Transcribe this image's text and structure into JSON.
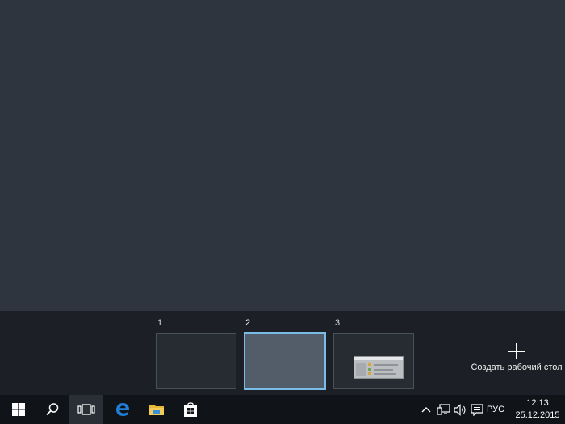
{
  "virtual_desktops": {
    "items": [
      {
        "number": "1",
        "active": false,
        "has_window": false
      },
      {
        "number": "2",
        "active": true,
        "has_window": false
      },
      {
        "number": "3",
        "active": false,
        "has_window": true
      }
    ],
    "create_label": "Создать рабочий стол"
  },
  "taskbar": {
    "buttons": [
      {
        "name": "start-button",
        "icon": "windows-logo-icon"
      },
      {
        "name": "search-button",
        "icon": "search-icon"
      },
      {
        "name": "task-view-button",
        "icon": "task-view-icon",
        "active": true
      },
      {
        "name": "edge-button",
        "icon": "edge-icon"
      },
      {
        "name": "file-explorer-button",
        "icon": "folder-icon"
      },
      {
        "name": "store-button",
        "icon": "store-icon"
      }
    ],
    "tray": {
      "icons": [
        "chevron-up-icon",
        "network-icon",
        "volume-icon",
        "action-center-icon"
      ],
      "language": "РУС",
      "time": "12:13",
      "date": "25.12.2015"
    }
  },
  "colors": {
    "desktop_bg": "#2f353e",
    "strip_bg": "#1c2026",
    "taskbar_bg": "#101317",
    "active_border": "#79bde6",
    "edge_blue": "#1f7ed6"
  }
}
